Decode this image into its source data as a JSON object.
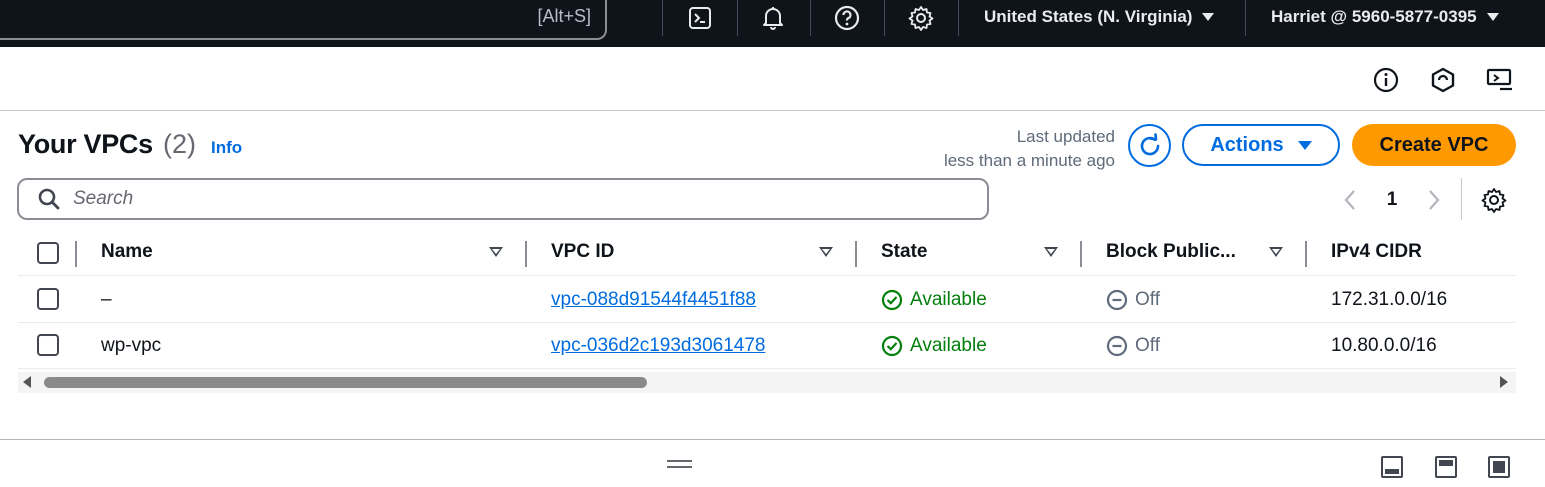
{
  "topnav": {
    "search_shortcut": "[Alt+S]",
    "region": "United States (N. Virginia)",
    "account": "Harriet @ 5960-5877-0395",
    "icons": [
      "cloudshell-icon",
      "bell-icon",
      "help-icon",
      "gear-icon"
    ]
  },
  "header": {
    "title": "Your VPCs",
    "count": "(2)",
    "info": "Info",
    "last_updated_line1": "Last updated",
    "last_updated_line2": "less than a minute ago",
    "actions_label": "Actions",
    "create_label": "Create VPC"
  },
  "search": {
    "placeholder": "Search"
  },
  "pagination": {
    "current_page": "1"
  },
  "table": {
    "columns": [
      "Name",
      "VPC ID",
      "State",
      "Block Public...",
      "IPv4 CIDR"
    ],
    "rows": [
      {
        "name": "–",
        "vpc_id": "vpc-088d91544f4451f88",
        "state": "Available",
        "block_public": "Off",
        "ipv4_cidr": "172.31.0.0/16"
      },
      {
        "name": "wp-vpc",
        "vpc_id": "vpc-036d2c193d3061478",
        "state": "Available",
        "block_public": "Off",
        "ipv4_cidr": "10.80.0.0/16"
      }
    ]
  },
  "colors": {
    "nav_bg": "#0f141a",
    "accent_blue": "#006ce0",
    "primary_orange": "#ff9900",
    "success_green": "#037f0c"
  }
}
